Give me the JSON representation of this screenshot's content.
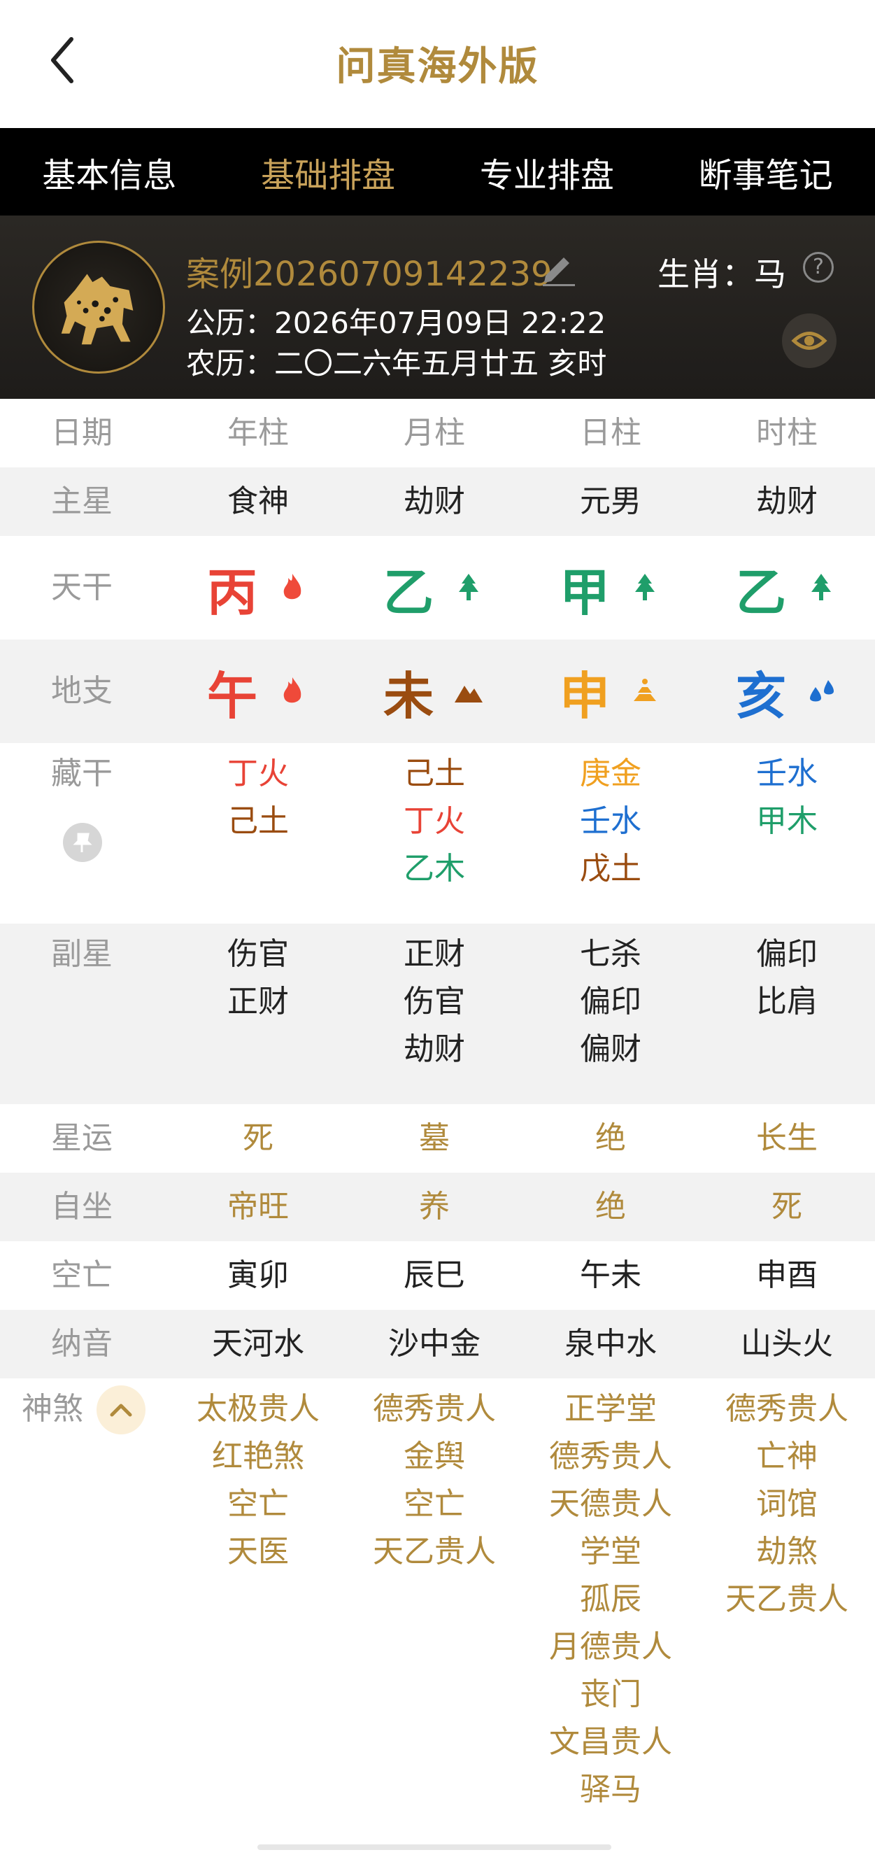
{
  "header": {
    "title": "问真海外版"
  },
  "tabs": [
    {
      "label": "基本信息",
      "active": false
    },
    {
      "label": "基础排盘",
      "active": true
    },
    {
      "label": "专业排盘",
      "active": false
    },
    {
      "label": "断事笔记",
      "active": false
    }
  ],
  "profile": {
    "case_name": "案例20260709142239",
    "zodiac_label": "生肖：马",
    "solar": "公历：2026年07月09日 22:22",
    "lunar": "农历：二〇二六年五月廿五  亥时"
  },
  "table": {
    "header": {
      "label": "日期",
      "cols": [
        "年柱",
        "月柱",
        "日柱",
        "时柱"
      ]
    },
    "main_star": {
      "label": "主星",
      "cols": [
        "食神",
        "劫财",
        "元男",
        "劫财"
      ]
    },
    "tiangan": {
      "label": "天干",
      "cols": [
        "丙",
        "乙",
        "甲",
        "乙"
      ],
      "elements": [
        "fire-icon",
        "tree-icon",
        "tree-icon",
        "tree-icon"
      ]
    },
    "dizhi": {
      "label": "地支",
      "cols": [
        "午",
        "未",
        "申",
        "亥"
      ],
      "elements": [
        "fire-icon",
        "mountain-icon",
        "metal-icon",
        "water-icon"
      ]
    },
    "canggan": {
      "label": "藏干",
      "cols": [
        [
          "丁火",
          "己土"
        ],
        [
          "己土",
          "丁火",
          "乙木"
        ],
        [
          "庚金",
          "壬水",
          "戊土"
        ],
        [
          "壬水",
          "甲木"
        ]
      ]
    },
    "fuxing": {
      "label": "副星",
      "cols": [
        [
          "伤官",
          "正财"
        ],
        [
          "正财",
          "伤官",
          "劫财"
        ],
        [
          "七杀",
          "偏印",
          "偏财"
        ],
        [
          "偏印",
          "比肩"
        ]
      ]
    },
    "xingyun": {
      "label": "星运",
      "cols": [
        "死",
        "墓",
        "绝",
        "长生"
      ]
    },
    "zizuo": {
      "label": "自坐",
      "cols": [
        "帝旺",
        "养",
        "绝",
        "死"
      ]
    },
    "kongwang": {
      "label": "空亡",
      "cols": [
        "寅卯",
        "辰巳",
        "午未",
        "申酉"
      ]
    },
    "nayin": {
      "label": "纳音",
      "cols": [
        "天河水",
        "沙中金",
        "泉中水",
        "山头火"
      ]
    },
    "shensha": {
      "label": "神煞",
      "cols": [
        [
          "太极贵人",
          "红艳煞",
          "空亡",
          "天医"
        ],
        [
          "德秀贵人",
          "金舆",
          "空亡",
          "天乙贵人"
        ],
        [
          "正学堂",
          "德秀贵人",
          "天德贵人",
          "学堂",
          "孤辰",
          "月德贵人",
          "丧门",
          "文昌贵人",
          "驿马"
        ],
        [
          "德秀贵人",
          "亡神",
          "词馆",
          "劫煞",
          "天乙贵人"
        ]
      ]
    }
  },
  "colors": {
    "gold": "#b08a3c",
    "fire": "#e84336",
    "wood": "#1f9e6a",
    "earth": "#9a4c10",
    "metal": "#f0a020",
    "water": "#1e6fd0"
  }
}
